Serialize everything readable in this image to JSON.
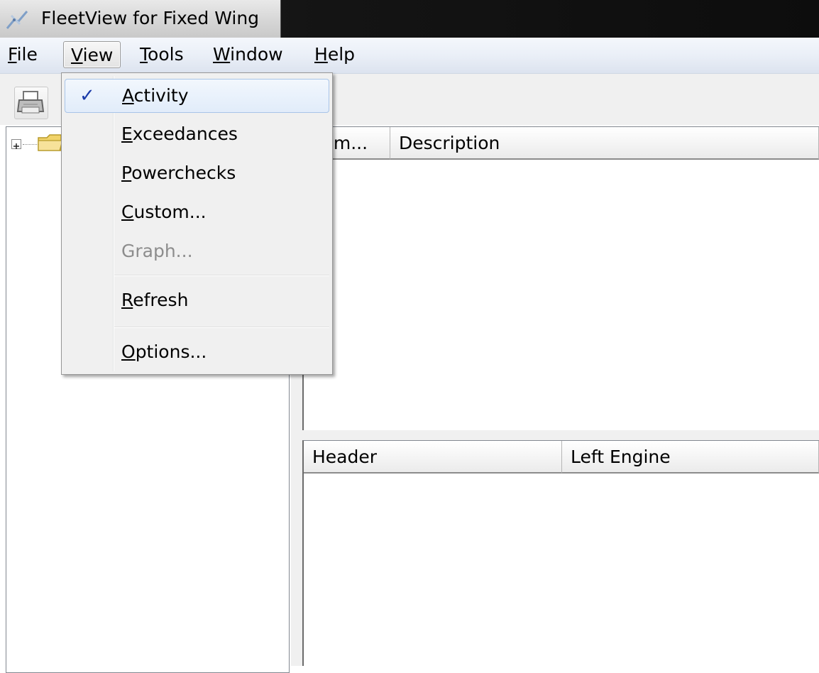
{
  "window": {
    "title": "FleetView for Fixed Wing",
    "icon": "app-icon"
  },
  "menubar": {
    "items": [
      {
        "pre": "",
        "u": "F",
        "post": "ile"
      },
      {
        "pre": "",
        "u": "V",
        "post": "iew"
      },
      {
        "pre": "",
        "u": "T",
        "post": "ools"
      },
      {
        "pre": "",
        "u": "W",
        "post": "indow"
      },
      {
        "pre": "",
        "u": "H",
        "post": "elp"
      }
    ],
    "active": "View"
  },
  "toolbar": {
    "print_icon": "printer-icon"
  },
  "tree": {
    "expander_icon": "plus-box-icon",
    "folder_icon": "folder-icon"
  },
  "upper_grid": {
    "columns": [
      "um...",
      "Description"
    ]
  },
  "lower_grid": {
    "columns": [
      "Header",
      "Left Engine"
    ]
  },
  "view_menu": {
    "items": [
      {
        "pre": "",
        "u": "A",
        "post": "ctivity",
        "checked": true
      },
      {
        "pre": "",
        "u": "E",
        "post": "xceedances"
      },
      {
        "pre": "",
        "u": "P",
        "post": "owerchecks"
      },
      {
        "pre": "",
        "u": "C",
        "post": "ustom..."
      },
      {
        "pre": "Graph...",
        "u": "",
        "post": "",
        "disabled": true
      },
      {
        "pre": "",
        "u": "R",
        "post": "efresh"
      },
      {
        "pre": "",
        "u": "O",
        "post": "ptions..."
      }
    ],
    "check_glyph": "✓"
  },
  "colors": {
    "check": "#1a3aa8",
    "hover_border": "#a8c4e8",
    "disabled_text": "#8d8d8d"
  }
}
